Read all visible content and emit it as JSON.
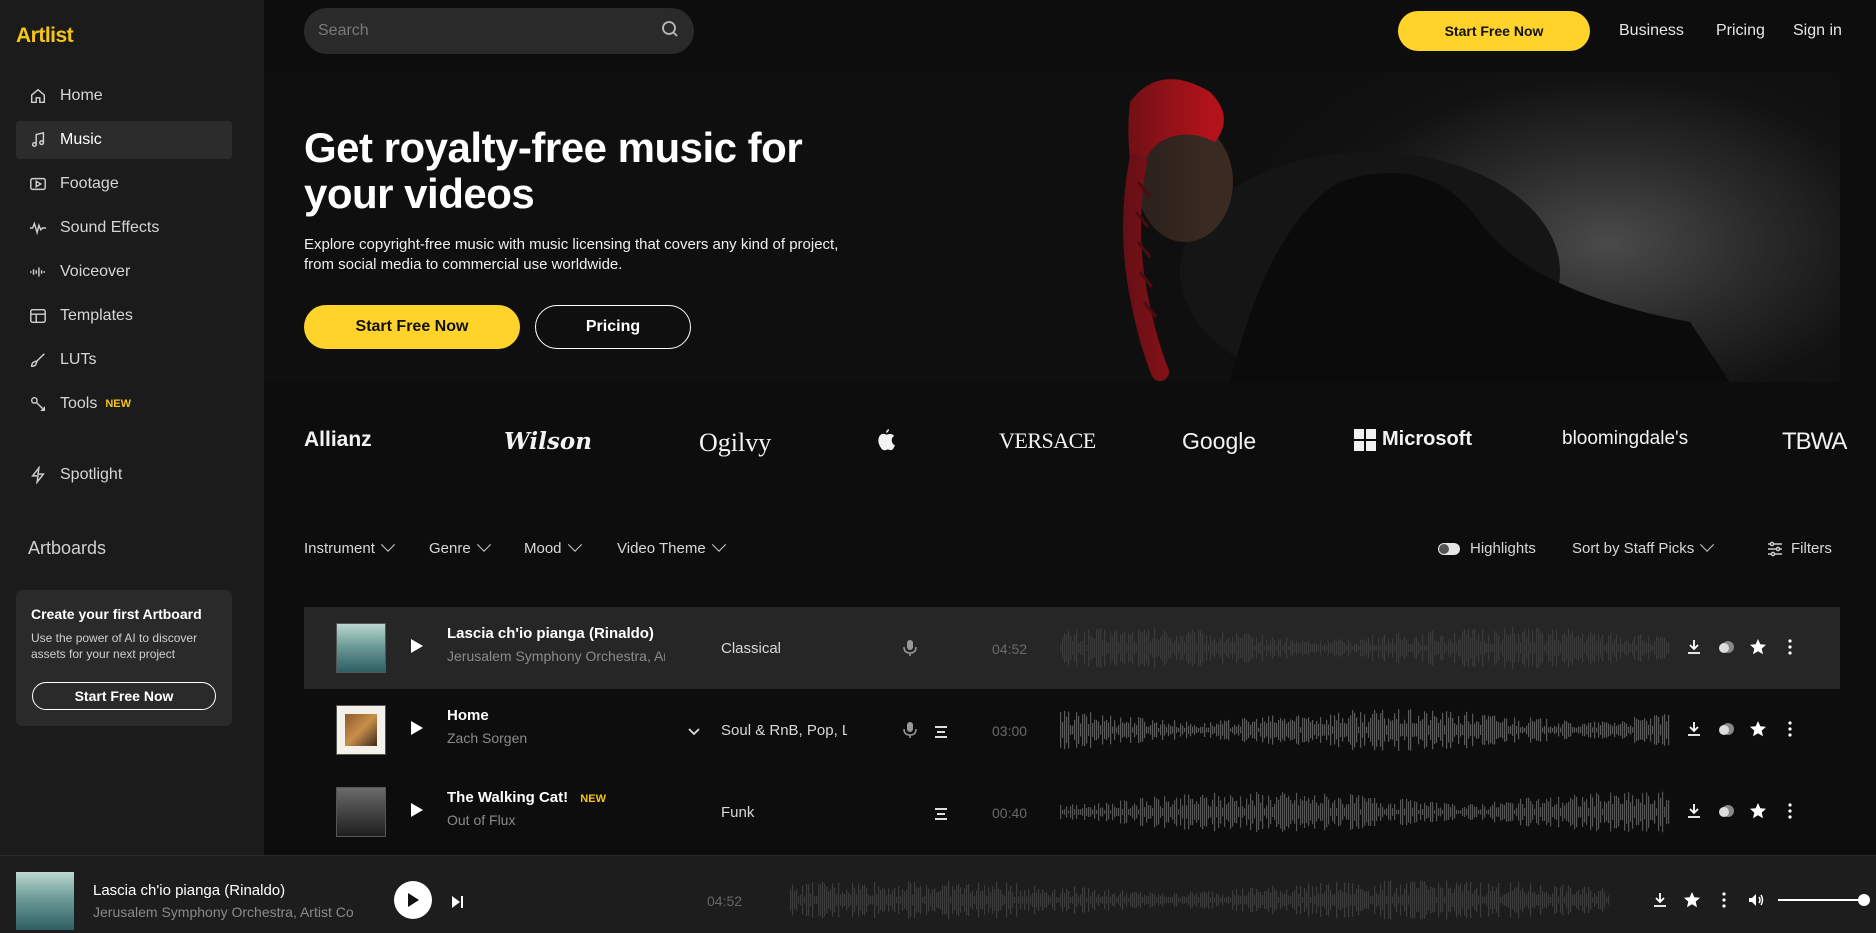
{
  "app": {
    "logo": "Artlist"
  },
  "sidebar": {
    "items": [
      {
        "label": "Home",
        "icon": "home-icon"
      },
      {
        "label": "Music",
        "icon": "music-note-icon",
        "active": true
      },
      {
        "label": "Footage",
        "icon": "video-icon"
      },
      {
        "label": "Sound Effects",
        "icon": "waveform-icon"
      },
      {
        "label": "Voiceover",
        "icon": "voice-bars-icon"
      },
      {
        "label": "Templates",
        "icon": "template-icon"
      },
      {
        "label": "LUTs",
        "icon": "brush-icon"
      },
      {
        "label": "Tools",
        "icon": "tools-icon",
        "badge": "NEW"
      }
    ],
    "spotlight": {
      "label": "Spotlight",
      "icon": "lightning-icon"
    },
    "artboards": {
      "title": "Artboards",
      "card_title": "Create your first Artboard",
      "card_text": "Use the power of AI to discover assets for your next project",
      "button": "Start Free Now"
    }
  },
  "header": {
    "search_placeholder": "Search",
    "cta": "Start Free Now",
    "links": [
      "Business",
      "Pricing",
      "Sign in"
    ]
  },
  "hero": {
    "title": "Get royalty-free music for your videos",
    "subtitle": "Explore copyright-free music with music licensing that covers any kind of project, from social media to commercial use worldwide.",
    "primary_button": "Start Free Now",
    "secondary_button": "Pricing"
  },
  "brands": [
    "Allianz",
    "Wilson",
    "Ogilvy",
    "Apple",
    "VERSACE",
    "Google",
    "Microsoft",
    "bloomingdale's",
    "TBWA"
  ],
  "filters": {
    "left": [
      "Instrument",
      "Genre",
      "Mood",
      "Video Theme"
    ],
    "highlights": "Highlights",
    "sort": "Sort by Staff Picks",
    "filters": "Filters"
  },
  "tracks": [
    {
      "title": "Lascia ch'io pianga (Rinaldo)",
      "artist": "Jerusalem Symphony Orchestra, Artist Collective",
      "genre": "Classical",
      "duration": "04:52",
      "vocal": true,
      "stems": false,
      "badge": ""
    },
    {
      "title": "Home",
      "artist": "Zach Sorgen",
      "genre": "Soul & RnB, Pop, Lo-fi",
      "duration": "03:00",
      "vocal": true,
      "stems": true,
      "badge": ""
    },
    {
      "title": "The Walking Cat!",
      "artist": "Out of Flux",
      "genre": "Funk",
      "duration": "00:40",
      "vocal": false,
      "stems": true,
      "badge": "NEW"
    }
  ],
  "player": {
    "title": "Lascia ch'io pianga (Rinaldo)",
    "artist": "Jerusalem Symphony Orchestra, Artist Collective",
    "duration": "04:52",
    "volume_level": 1.0
  },
  "colors": {
    "accent": "#ffd32a",
    "background": "#0d0d0d",
    "sidebar": "#1b1b1b"
  }
}
